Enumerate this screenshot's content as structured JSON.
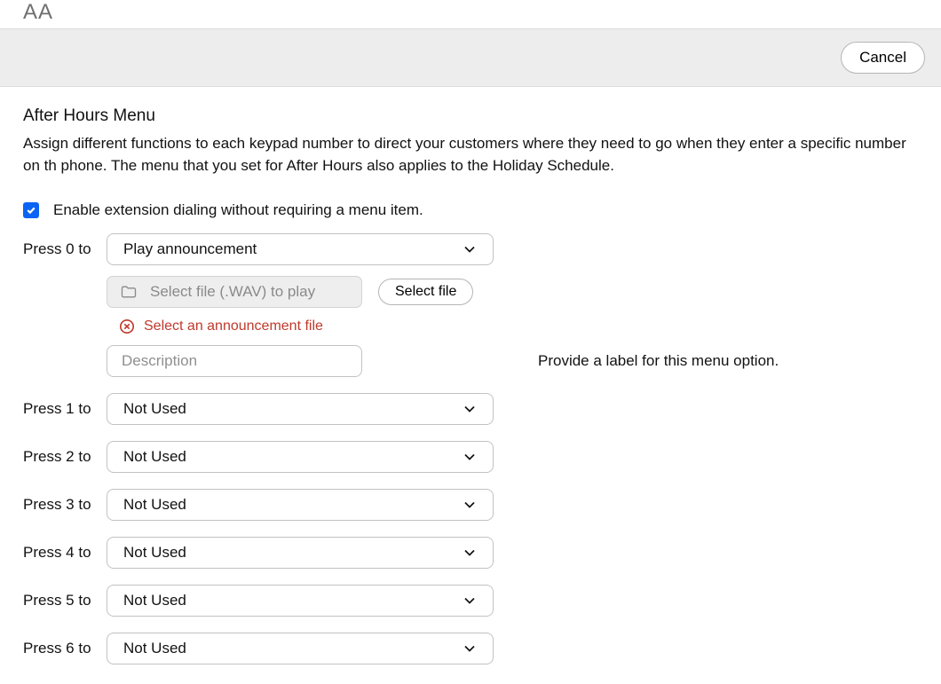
{
  "pageTitle": "AA",
  "toolbar": {
    "cancel": "Cancel"
  },
  "section": {
    "heading": "After Hours Menu",
    "description": "Assign different functions to each keypad number to direct your customers where they need to go when they enter a specific number on th phone. The menu that you set for After Hours also applies to the Holiday Schedule."
  },
  "checkbox": {
    "checked": true,
    "label": "Enable extension dialing without requiring a menu item."
  },
  "press0": {
    "label": "Press 0 to",
    "selectValue": "Play announcement",
    "filePlaceholder": "Select file (.WAV) to play",
    "selectFileBtn": "Select file",
    "errorText": "Select an announcement file",
    "descPlaceholder": "Description",
    "sideHint": "Provide a label for this menu option."
  },
  "rows": [
    {
      "label": "Press 1 to",
      "value": "Not Used"
    },
    {
      "label": "Press 2 to",
      "value": "Not Used"
    },
    {
      "label": "Press 3 to",
      "value": "Not Used"
    },
    {
      "label": "Press 4 to",
      "value": "Not Used"
    },
    {
      "label": "Press 5 to",
      "value": "Not Used"
    },
    {
      "label": "Press 6 to",
      "value": "Not Used"
    }
  ]
}
